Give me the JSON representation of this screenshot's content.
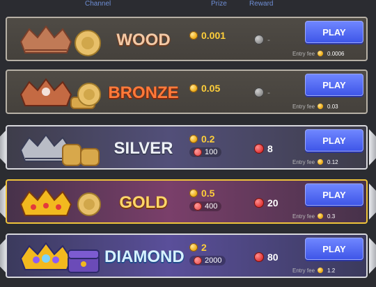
{
  "header": {
    "channel": "Channel",
    "prize": "Prize",
    "reward": "Reward"
  },
  "rows": [
    {
      "tier": "wood",
      "title": "WOOD",
      "prize": "0.001",
      "tickets": "",
      "reward": "-",
      "reward_active": false,
      "play": "PLAY",
      "fee_label": "Entry fee",
      "fee": "0.0006"
    },
    {
      "tier": "bronze",
      "title": "BRONZE",
      "prize": "0.05",
      "tickets": "",
      "reward": "-",
      "reward_active": false,
      "play": "PLAY",
      "fee_label": "Entry fee",
      "fee": "0.03"
    },
    {
      "tier": "silver",
      "title": "SILVER",
      "prize": "0.2",
      "tickets": "100",
      "reward": "8",
      "reward_active": true,
      "play": "PLAY",
      "fee_label": "Entry fee",
      "fee": "0.12"
    },
    {
      "tier": "gold",
      "title": "GOLD",
      "prize": "0.5",
      "tickets": "400",
      "reward": "20",
      "reward_active": true,
      "play": "PLAY",
      "fee_label": "Entry fee",
      "fee": "0.3"
    },
    {
      "tier": "diamond",
      "title": "DIAMOND",
      "prize": "2",
      "tickets": "2000",
      "reward": "80",
      "reward_active": true,
      "play": "PLAY",
      "fee_label": "Entry fee",
      "fee": "1.2"
    }
  ],
  "colors": {
    "accent": "#3f56e8",
    "gold_border": "#f0c43a"
  }
}
